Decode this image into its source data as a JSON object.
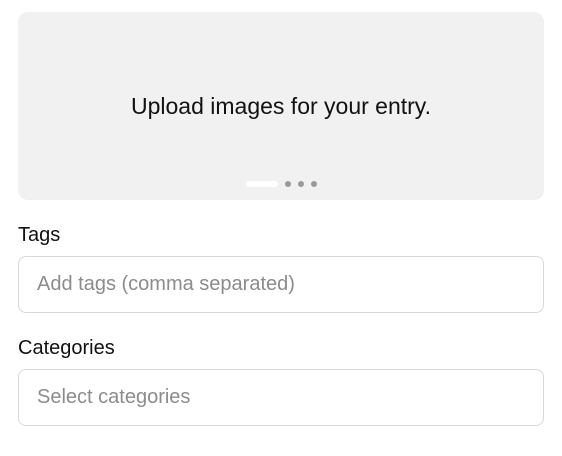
{
  "upload": {
    "prompt": "Upload images for your entry.",
    "carousel": {
      "pages": 4,
      "active_index": 0
    }
  },
  "tags": {
    "label": "Tags",
    "value": "",
    "placeholder": "Add tags (comma separated)"
  },
  "categories": {
    "label": "Categories",
    "placeholder": "Select categories"
  },
  "colors": {
    "upload_background": "#f1f1f1",
    "dot_inactive": "#9a9a9a",
    "dot_active": "#ffffff",
    "input_border": "#d8d8d8",
    "placeholder": "#8c8c8c"
  }
}
